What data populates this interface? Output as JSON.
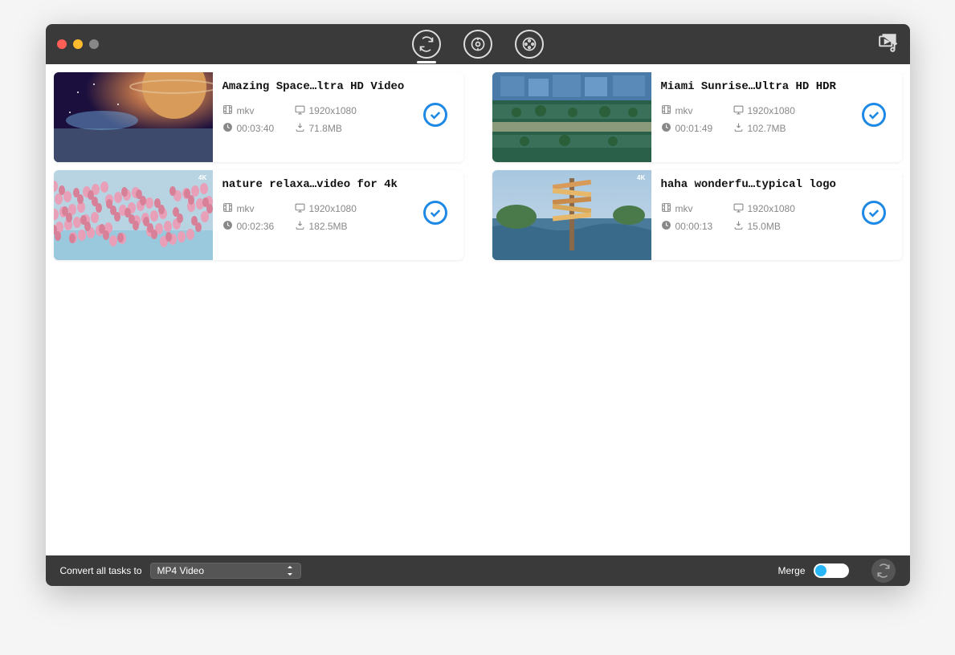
{
  "footer": {
    "convert_label": "Convert all tasks to",
    "format_selected": "MP4 Video",
    "merge_label": "Merge",
    "merge_on": false
  },
  "videos": [
    {
      "title": "Amazing Space…ltra HD Video",
      "format": "mkv",
      "resolution": "1920x1080",
      "duration": "00:03:40",
      "size": "71.8MB",
      "checked": true,
      "thumb": "space"
    },
    {
      "title": "Miami Sunrise…Ultra HD HDR",
      "format": "mkv",
      "resolution": "1920x1080",
      "duration": "00:01:49",
      "size": "102.7MB",
      "checked": true,
      "thumb": "miami"
    },
    {
      "title": "nature relaxa…video for 4k",
      "format": "mkv",
      "resolution": "1920x1080",
      "duration": "00:02:36",
      "size": "182.5MB",
      "checked": true,
      "thumb": "flamingo"
    },
    {
      "title": "haha wonderfu…typical logo",
      "format": "mkv",
      "resolution": "1920x1080",
      "duration": "00:00:13",
      "size": "15.0MB",
      "checked": true,
      "thumb": "signpost"
    }
  ]
}
